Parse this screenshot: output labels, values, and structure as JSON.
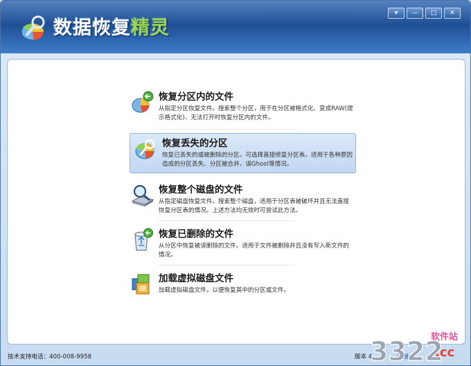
{
  "app": {
    "title_part1": "数据恢复",
    "title_part2": "精灵"
  },
  "window_controls": {
    "menu": "▾",
    "minimize": "—",
    "maximize": "□",
    "close": "✕"
  },
  "menu_items": [
    {
      "title": "恢复分区内的文件",
      "desc": "从指定分区恢复文件。搜索整个分区，用于在分区被格式化、变成RAW(提示格式化)、无法打开时恢复分区内的文件。",
      "icon": "partition-files-icon"
    },
    {
      "title": "恢复丢失的分区",
      "desc": "恢复已丢失的或被删除的分区。可选择直接修复分区表。适用于各种原因造成的分区丢失、分区被合并、误Ghost等情况。",
      "icon": "lost-partition-icon",
      "selected": true
    },
    {
      "title": "恢复整个磁盘的文件",
      "desc": "从指定磁盘恢复文件。搜索整个磁盘，适用于分区表被破坏并且无法直接恢复分区表的情况。上述方法均无效时可尝试此方法。",
      "icon": "disk-search-icon"
    },
    {
      "title": "恢复已删除的文件",
      "desc": "从分区中恢复被误删除的文件。适用于文件被删除并且没有写入新文件的情况。",
      "icon": "recycle-bin-icon"
    },
    {
      "title": "加载虚拟磁盘文件",
      "desc": "加载虚拟磁盘文件，以便恢复其中的分区或文件。",
      "icon": "virtual-disk-icon"
    }
  ],
  "status": {
    "phone": "技术支持电话：400-008-9958",
    "version": "版本 4.",
    "register": "注册"
  },
  "watermark": {
    "number": "3322",
    "site": "软件站",
    "domain": ".cc"
  },
  "colors": {
    "titlebar": "#2f66b0",
    "accent_green": "#9cd84a",
    "selection": "#c2d7f2"
  }
}
